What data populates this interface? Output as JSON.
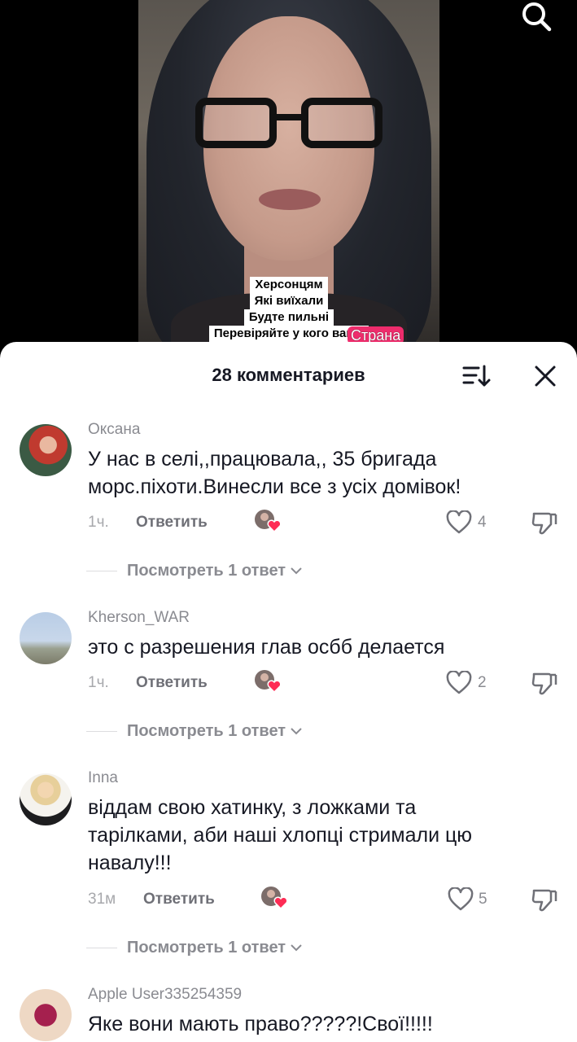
{
  "video": {
    "caption_lines": [
      "Херсонцям",
      "Які виїхали",
      "Будте пильні",
      "Перевіряйте у кого ваши"
    ],
    "brand_tag": "Страна",
    "search_icon": "search-icon"
  },
  "comments_sheet": {
    "title": "28 комментариев",
    "sort_icon": "sort-icon",
    "close_icon": "close-icon",
    "reply_label": "Ответить",
    "view_replies_label": "Посмотреть 1 ответ",
    "comments": [
      {
        "author": "Оксана",
        "text": "У нас в селі,,працювала,, 35 бригада морс.піхоти.Винесли все з усіх домівок!",
        "time": "1ч.",
        "likes": "4"
      },
      {
        "author": "Kherson_WAR",
        "text": "это с разрешения глав осбб делается",
        "time": "1ч.",
        "likes": "2"
      },
      {
        "author": "Inna",
        "text": "віддам свою хатинку, з ложками та тарілками, аби наші хлопці стримали цю навалу!!!",
        "time": "31м",
        "likes": "5"
      },
      {
        "author": "Apple User335254359",
        "text": "Яке вони мають право?????!Свої!!!!!"
      }
    ]
  },
  "colors": {
    "text_primary": "#161823",
    "text_secondary": "#8a8b91",
    "like_heart": "#fe2c55",
    "brand_tag": "#ee2c6c"
  }
}
